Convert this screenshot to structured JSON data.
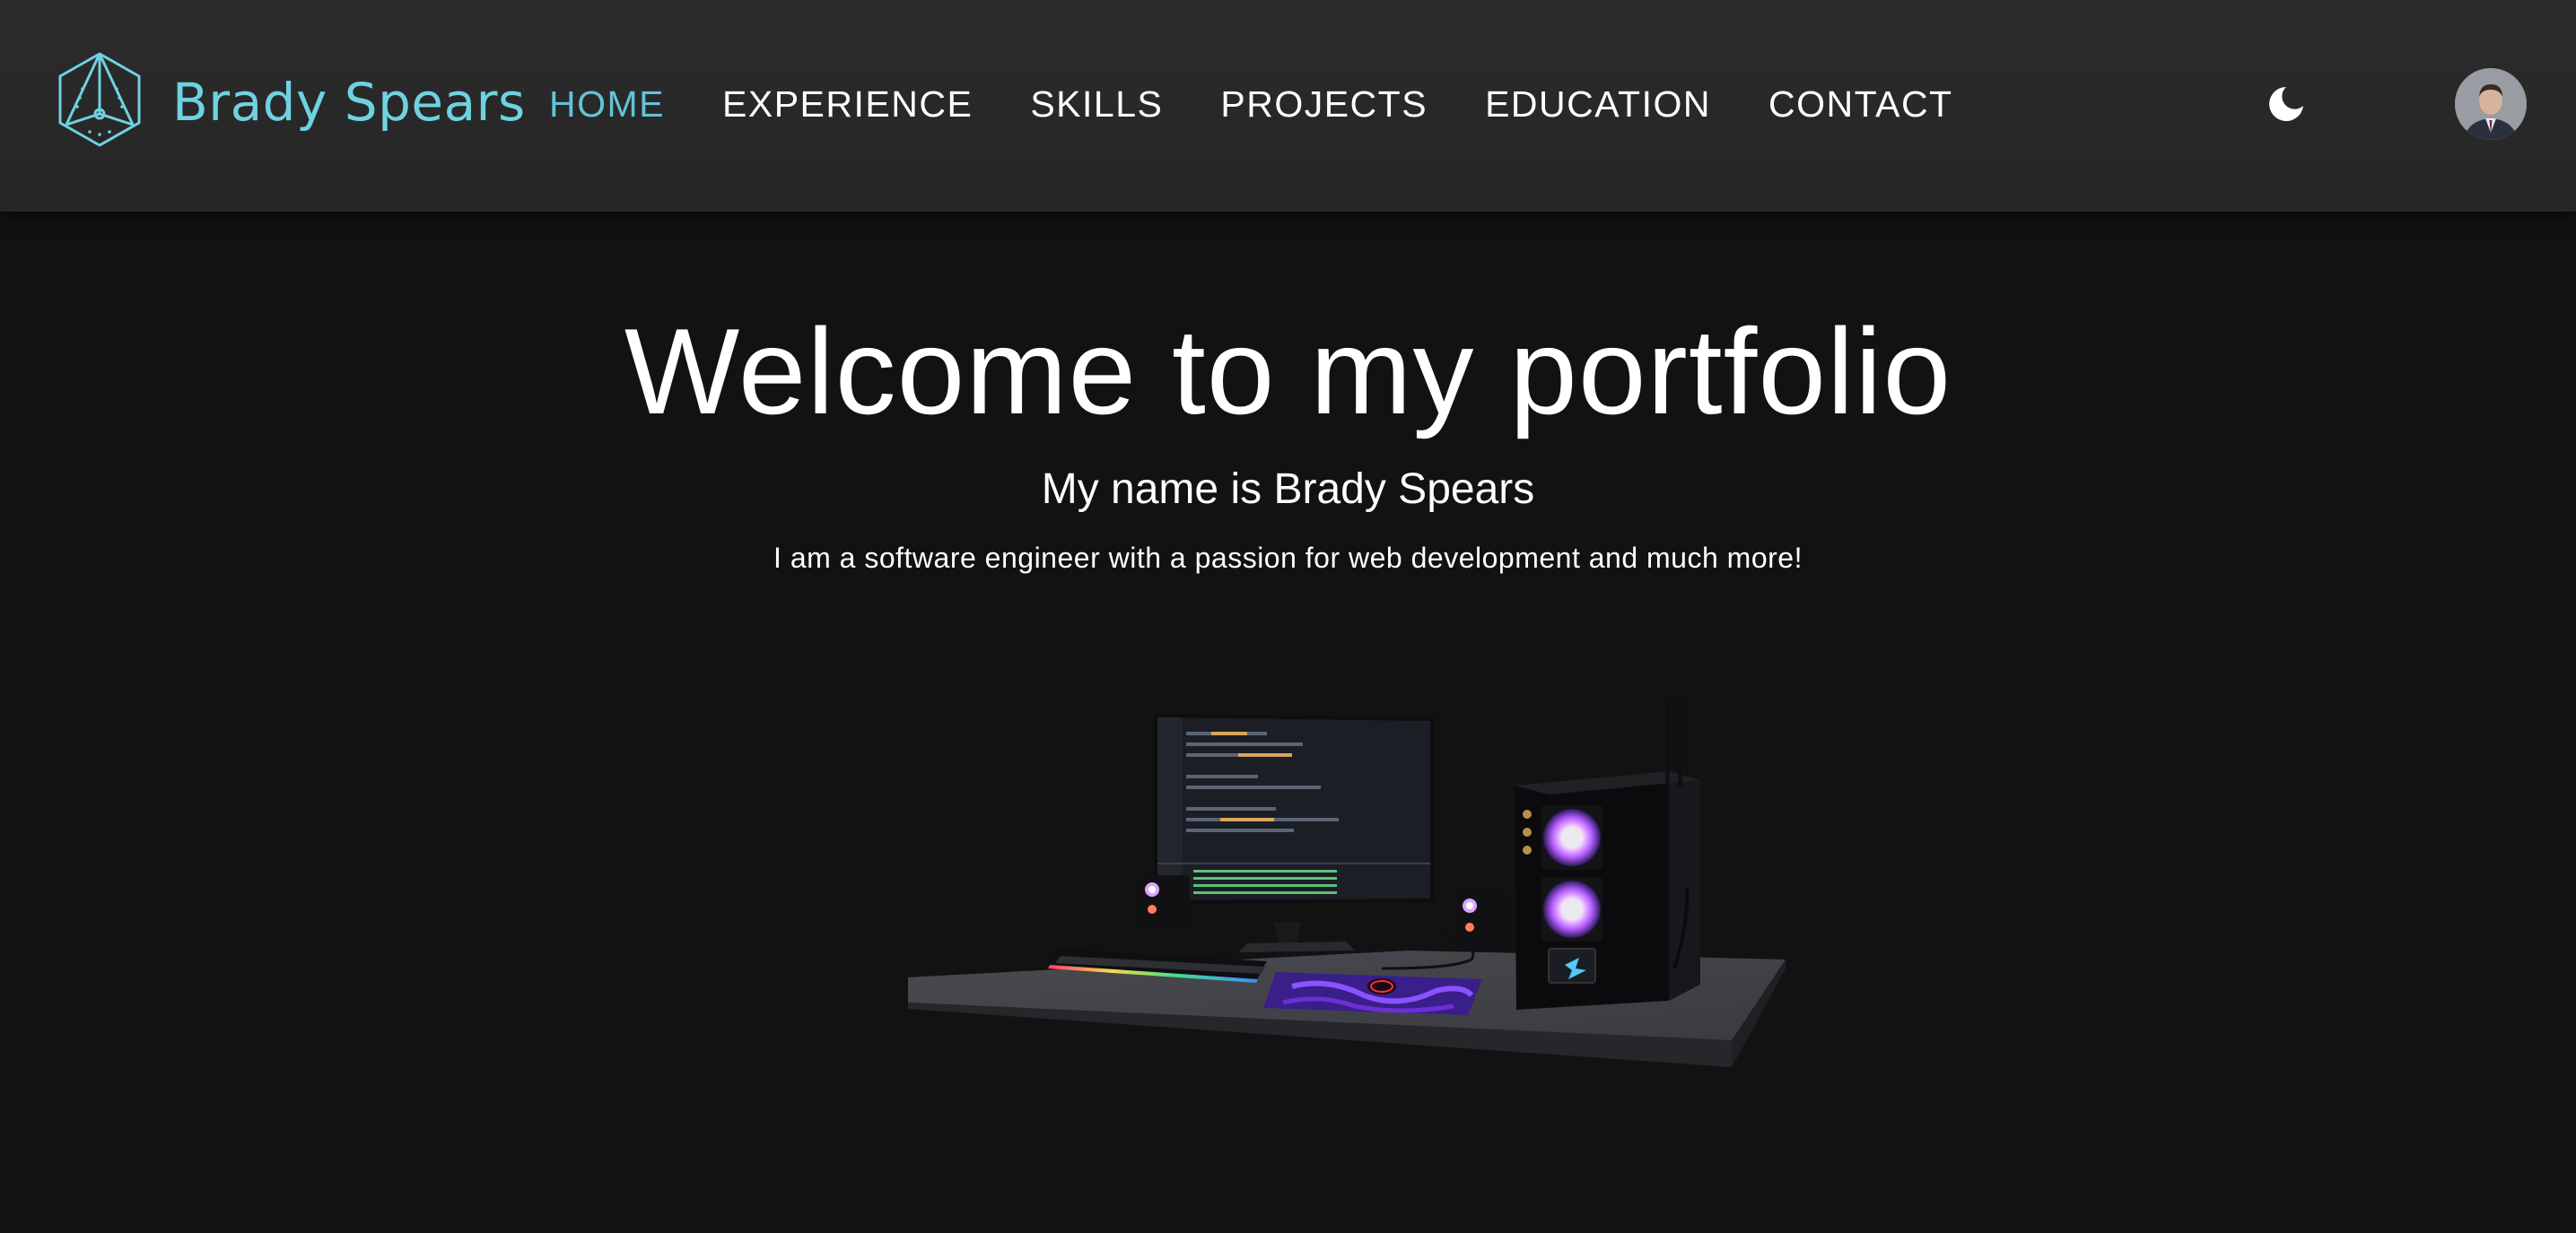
{
  "brand": {
    "name": "Brady Spears",
    "logo_icon": "geometric-prism-logo",
    "color": "#6fd2e0"
  },
  "nav": {
    "items": [
      {
        "label": "HOME",
        "active": true
      },
      {
        "label": "EXPERIENCE",
        "active": false
      },
      {
        "label": "SKILLS",
        "active": false
      },
      {
        "label": "PROJECTS",
        "active": false
      },
      {
        "label": "EDUCATION",
        "active": false
      },
      {
        "label": "CONTACT",
        "active": false
      }
    ],
    "active_color": "#63c3d8",
    "theme_toggle_icon": "moon-icon",
    "avatar_icon": "profile-photo"
  },
  "hero": {
    "title": "Welcome to my portfolio",
    "subtitle": "My name is Brady Spears",
    "text": "I am a software engineer with a passion for web development and much more!"
  },
  "scene": {
    "description_icon": "desk-setup-3d-model"
  },
  "colors": {
    "background": "#121212",
    "navbar": "#2a2a2a",
    "text": "#ffffff"
  }
}
